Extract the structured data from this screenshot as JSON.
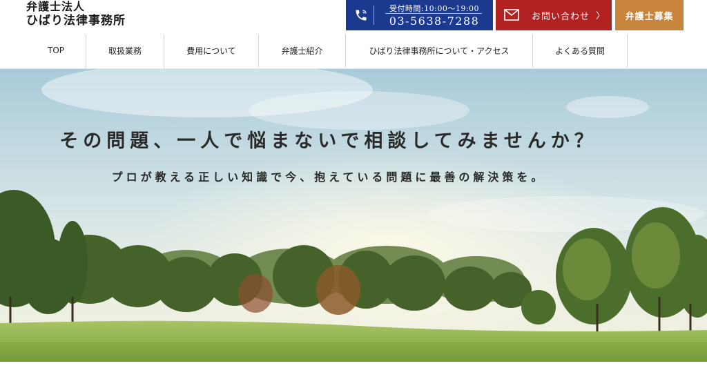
{
  "logo": {
    "line1": "弁護士法人",
    "line2": "ひばり法律事務所"
  },
  "tel": {
    "hours": "受付時間:10:00〜19:00",
    "number": "03-5638-7288",
    "icon": "phone-icon"
  },
  "contact": {
    "label": "お問い合わせ",
    "arrow": "〉",
    "icon": "mail-icon"
  },
  "recruit": {
    "label": "弁護士募集"
  },
  "nav": {
    "items": [
      {
        "label": "TOP"
      },
      {
        "label": "取扱業務"
      },
      {
        "label": "費用について"
      },
      {
        "label": "弁護士紹介"
      },
      {
        "label": "ひばり法律事務所について・アクセス"
      },
      {
        "label": "よくある質問"
      }
    ]
  },
  "hero": {
    "title": "その問題、一人で悩まないで相談してみませんか？",
    "subtitle": "プロが教える正しい知識で今、抱えている問題に最善の解決策を。"
  },
  "colors": {
    "tel_bg": "#1b3a8f",
    "contact_bg": "#b22222",
    "recruit_bg": "#c8843a"
  }
}
